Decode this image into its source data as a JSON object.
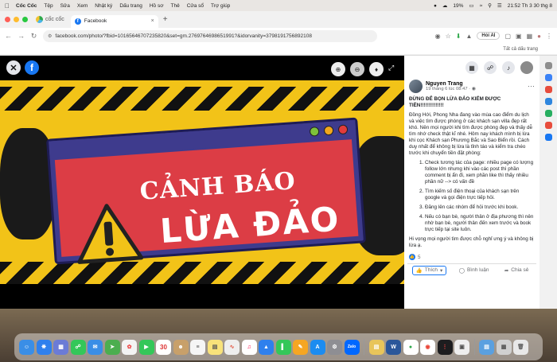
{
  "menubar": {
    "app": "Cốc Cốc",
    "items": [
      "Tệp",
      "Sửa",
      "Xem",
      "Nhật ký",
      "Dấu trang",
      "Hồ sơ",
      "Thẻ",
      "Cửa sổ",
      "Trợ giúp"
    ],
    "battery": "19%",
    "clock": "21:52 Th 3 30 thg 8"
  },
  "browser": {
    "brand": "cốc cốc",
    "tab_title": "Facebook",
    "url": "facebook.com/photo/?fbid=10165646707235820&set=gm.2769764698651991?&idorvanity=3798191756892108",
    "ai_button": "Hỏi AI",
    "bookmarks_label": "Tất cả dấu trang"
  },
  "viewer": {
    "fb_letter": "f",
    "sign_title_line1": "CẢNH BÁO",
    "sign_title_line2": "LỪA ĐẢO"
  },
  "post": {
    "author": "Nguyen Trang",
    "date": "19 tháng 6 lúc 08:47 · ",
    "title": "ĐỪNG ĐỂ BỌN LỪA ĐẢO KIẾM ĐƯỢC TIỀN!!!!!!!!!!!!!!",
    "intro": "Đồng Hới, Phong Nha đang vào mùa cao điểm du lịch và việc tìm được phòng ở các khách sạn villa đẹp rất khó. Nên mọi người khi tìm được phòng đẹp và thấy dễ tìm nhớ check thật kĩ nhé. Hôm nay khách mình bị lừa khi cọc Khách sạn Phương Bắc và Sao Biển rồi. Cách duy nhất để không bị lừa là tỉnh táo và kiểm tra chéo trước khi chuyển tiền đặt phòng:",
    "tips": [
      "Check tương tác của page: nhiều page có lượng follow lớn nhưng khi vào các post thì phần comment bị ẩn đi, xem phần like thì thấy nhiều phần nữ --> có vấn đề",
      "Tìm kiếm số điện thoại của khách sạn trên google và gọi điện trực tiếp hỏi.",
      "Đăng lên các nhóm để hỏi trước khi book.",
      "Nếu có bạn bè, người thân ở địa phương thì nên nhờ bạn bè, người thân đến xem trước và book trực tiếp tại site luôn."
    ],
    "outro": "Hi vọng mọi người tìm được chỗ nghỉ ưng ý và không bị lừa ạ.",
    "reaction_count": "5",
    "like_label": "Thích",
    "comment_label": "Bình luận",
    "share_label": "Chia sẻ"
  },
  "dock": {
    "calendar_day": "30",
    "zalo": "Zalo",
    "word": "W"
  },
  "colors": {
    "facebook_blue": "#1877f2",
    "banner_yellow": "#f2c318",
    "sign_red": "#dc3d45",
    "sign_navy": "#3e3b8d"
  }
}
